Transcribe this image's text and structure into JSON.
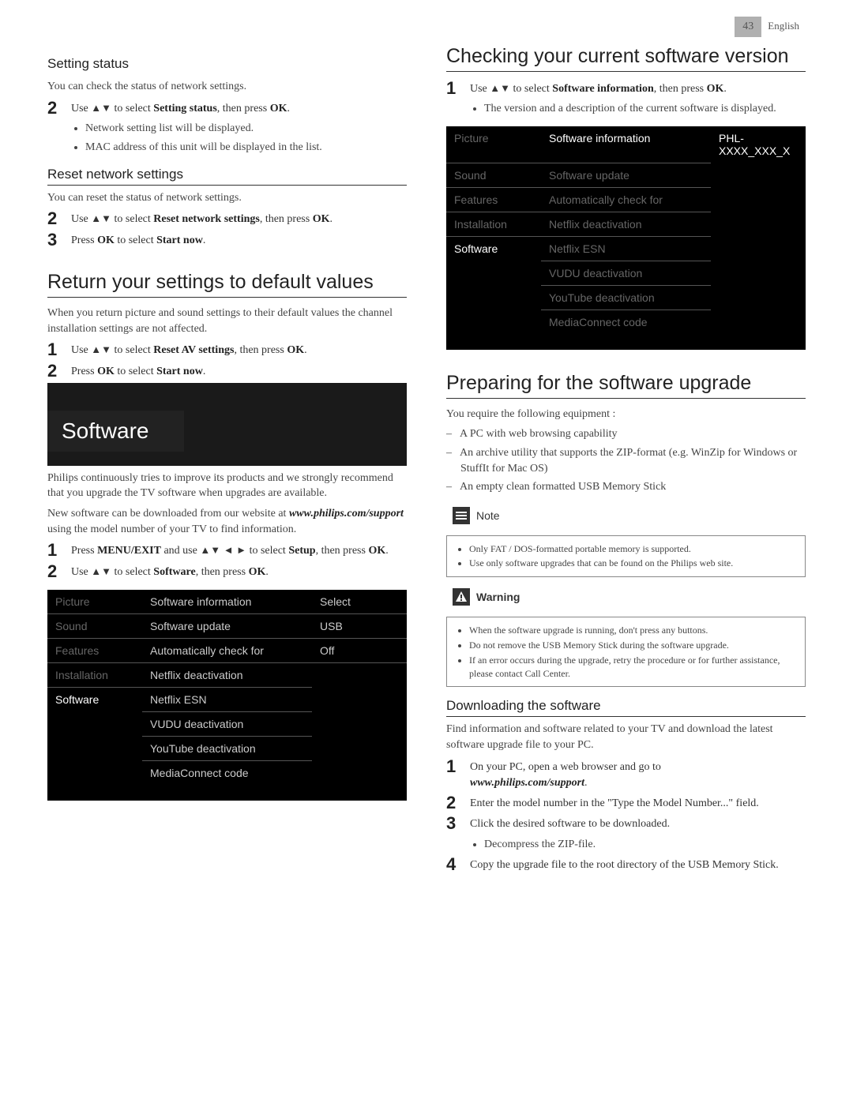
{
  "page": {
    "number": "43",
    "language": "English"
  },
  "left": {
    "setting_status": {
      "heading": "Setting status",
      "intro": "You can check the status of network settings.",
      "step2_pre": "Use ",
      "step2_mid": " to select ",
      "step2_sel": "Setting status",
      "step2_post": ", then press ",
      "ok": "OK",
      "bullets": [
        "Network setting list will be displayed.",
        "MAC address of this unit will be displayed in the list."
      ]
    },
    "reset_network": {
      "heading": "Reset network settings",
      "intro": "You can reset the status of network settings.",
      "step2_pre": "Use ",
      "step2_mid": " to select ",
      "step2_sel": "Reset network settings",
      "step2_post": ", then press ",
      "ok": "OK",
      "step3_pre": "Press ",
      "step3_mid": " to select ",
      "step3_sel": "Start now"
    },
    "return_defaults": {
      "heading": "Return your settings to default values",
      "intro": "When you return picture and sound settings to their default values the channel installation settings are not affected.",
      "step1_pre": "Use ",
      "step1_mid": " to select ",
      "step1_sel": "Reset AV settings",
      "step1_post": ", then press ",
      "ok": "OK",
      "step2_pre": "Press ",
      "step2_mid": " to select ",
      "step2_sel": "Start now"
    },
    "software_section": {
      "banner": "Software",
      "para1": "Philips continuously tries to improve its products and we strongly recommend that you upgrade the TV software when upgrades are available.",
      "para2a": "New software can be downloaded from our website at ",
      "url": "www.philips.com/support",
      "para2b": " using the model number of your TV to find information.",
      "step1_pre": "Press ",
      "menu": "MENU/EXIT",
      "step1_mid": " and use ",
      "step1_mid2": " to select ",
      "setup": "Setup",
      "step1_post": ", then press ",
      "ok": "OK",
      "step2_pre": "Use ",
      "step2_mid": " to select ",
      "step2_sel": "Software",
      "step2_post": ", then press "
    },
    "menu1": {
      "col1": [
        "Picture",
        "Sound",
        "Features",
        "Installation",
        "Software"
      ],
      "col2": [
        "Software information",
        "Software update",
        "Automatically check for",
        "Netflix deactivation",
        "Netflix ESN",
        "VUDU deactivation",
        "YouTube deactivation",
        "MediaConnect code"
      ],
      "col3": [
        "Select",
        "USB",
        "Off"
      ]
    }
  },
  "right": {
    "check_version": {
      "heading": "Checking your current software version",
      "step1_pre": "Use ",
      "step1_mid": " to select ",
      "step1_sel": "Software information",
      "step1_post": ", then press ",
      "ok": "OK",
      "bullet": "The version and a description of the current software is displayed."
    },
    "menu2": {
      "col1": [
        "Picture",
        "Sound",
        "Features",
        "Installation",
        "Software"
      ],
      "col2": [
        "Software information",
        "Software update",
        "Automatically check for",
        "Netflix deactivation",
        "Netflix ESN",
        "VUDU deactivation",
        "YouTube deactivation",
        "MediaConnect code"
      ],
      "col3": "PHL-XXXX_XXX_X"
    },
    "preparing": {
      "heading": "Preparing for the software upgrade",
      "intro": "You require the following equipment :",
      "items": [
        "A PC with web browsing capability",
        "An archive utility that supports the ZIP-format (e.g. WinZip for Windows or StuffIt for Mac OS)",
        "An empty clean formatted USB Memory Stick"
      ]
    },
    "note": {
      "title": "Note",
      "items": [
        "Only FAT / DOS-formatted portable memory is supported.",
        "Use only software upgrades that can be found on the Philips web site."
      ]
    },
    "warning": {
      "title": "Warning",
      "items": [
        "When the software upgrade is running, don't press any buttons.",
        "Do not remove the USB Memory Stick during the software upgrade.",
        "If an error occurs during the upgrade, retry the procedure or for further assistance, please contact Call Center."
      ]
    },
    "downloading": {
      "heading": "Downloading the software",
      "intro": "Find information and software related to your TV and download the latest software upgrade file to your PC.",
      "step1": "On your PC, open a web browser and go to ",
      "url": "www.philips.com/support",
      "step2": "Enter the model number in the \"Type the Model Number...\" field.",
      "step3": "Click the desired software to be downloaded.",
      "step3_bullet": "Decompress the ZIP-file.",
      "step4": "Copy the upgrade file to the root directory of the USB Memory Stick."
    }
  },
  "glyphs": {
    "updown": "▲▼",
    "all": "▲▼ ◄ ►",
    "dot": "."
  }
}
